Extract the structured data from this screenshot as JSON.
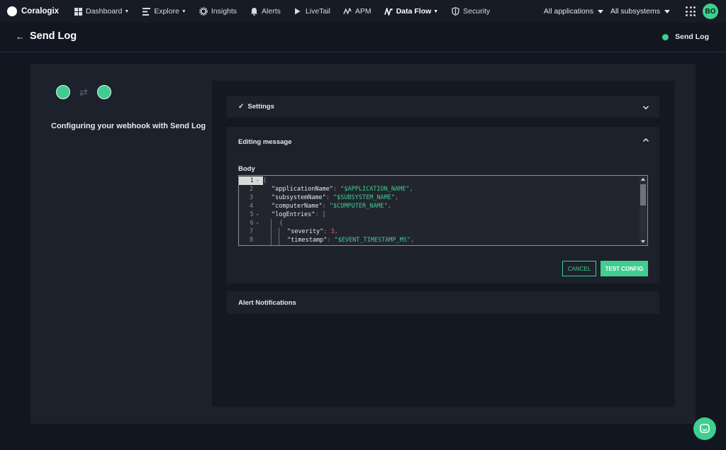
{
  "nav": {
    "brand": "Coralogix",
    "items": [
      {
        "label": "Dashboard",
        "icon": "grid-icon",
        "caret": true
      },
      {
        "label": "Explore",
        "icon": "explore-icon",
        "caret": true
      },
      {
        "label": "Insights",
        "icon": "gear-icon",
        "caret": false
      },
      {
        "label": "Alerts",
        "icon": "bell-icon",
        "caret": false
      },
      {
        "label": "LiveTail",
        "icon": "play-icon",
        "caret": false
      },
      {
        "label": "APM",
        "icon": "apm-icon",
        "caret": false
      },
      {
        "label": "Data Flow",
        "icon": "dataflow-icon",
        "caret": true
      },
      {
        "label": "Security",
        "icon": "shield-icon",
        "caret": false
      }
    ],
    "applications_select": "All applications",
    "subsystems_select": "All subsystems",
    "avatar_initials": "BO"
  },
  "subheader": {
    "back_icon": "←",
    "title": "Send Log",
    "status_label": "Send Log"
  },
  "left": {
    "swap_icon": "⇄",
    "title": "Configuring your webhook with Send Log"
  },
  "settings": {
    "check": "✓",
    "label": "Settings"
  },
  "editing": {
    "label": "Editing message",
    "body_label": "Body",
    "lines": [
      {
        "n": "1",
        "fold": true
      },
      {
        "n": "2",
        "fold": false
      },
      {
        "n": "3",
        "fold": false
      },
      {
        "n": "4",
        "fold": false
      },
      {
        "n": "5",
        "fold": true
      },
      {
        "n": "6",
        "fold": true
      },
      {
        "n": "7",
        "fold": false
      },
      {
        "n": "8",
        "fold": false
      }
    ],
    "code": {
      "l1": "{",
      "l2_key": "\"applicationName\"",
      "l2_val": "\"$APPLICATION_NAME\"",
      "l3_key": "\"subsystemName\"",
      "l3_val": "\"$SUBSYSTEM_NAME\"",
      "l4_key": "\"computerName\"",
      "l4_val": "\"$COMPUTER_NAME\"",
      "l5_key": "\"logEntries\"",
      "l5_val": "[",
      "l6": "{",
      "l7_key": "\"severity\"",
      "l7_val": "3",
      "l8_key": "\"timestamp\"",
      "l8_val": "\"$EVENT_TIMESTAMP_MS\"",
      "colon": ": ",
      "comma": ","
    },
    "cancel": "CANCEL",
    "test_config": "TEST CONFIG"
  },
  "alerts": {
    "label": "Alert Notifications"
  },
  "colors": {
    "accent": "#3fce8f",
    "background": "#121620",
    "panel": "#1c212c"
  }
}
